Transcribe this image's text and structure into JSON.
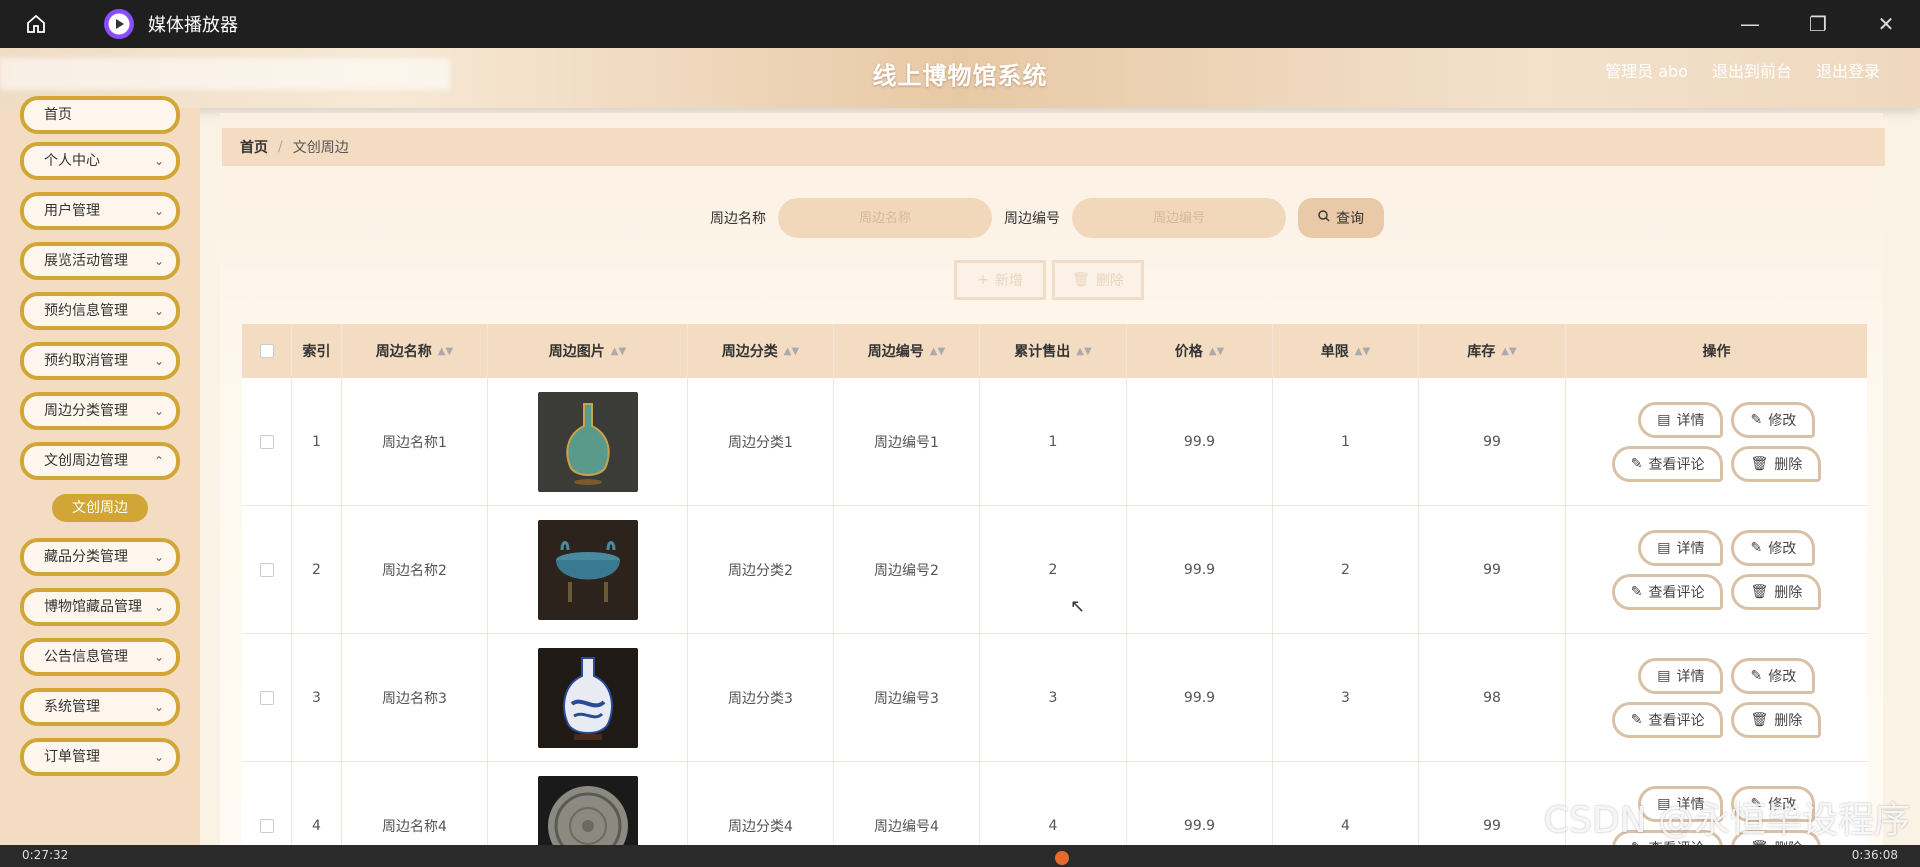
{
  "player": {
    "title": "媒体播放器",
    "time_left": "0:27:32",
    "time_right": "0:36:08"
  },
  "header": {
    "title": "线上博物馆系统",
    "admin": "管理员 abo",
    "front": "退出到前台",
    "logout": "退出登录"
  },
  "sidebar": {
    "items": [
      "首页",
      "个人中心",
      "用户管理",
      "展览活动管理",
      "预约信息管理",
      "预约取消管理",
      "周边分类管理",
      "文创周边管理",
      "藏品分类管理",
      "博物馆藏品管理",
      "公告信息管理",
      "系统管理",
      "订单管理"
    ],
    "active_sub": "文创周边"
  },
  "breadcrumb": {
    "home": "首页",
    "current": "文创周边"
  },
  "search": {
    "name_label": "周边名称",
    "name_placeholder": "周边名称",
    "code_label": "周边编号",
    "code_placeholder": "周边编号",
    "query": "查询"
  },
  "actions": {
    "add": "新增",
    "delete": "删除"
  },
  "table": {
    "headers": [
      "索引",
      "周边名称",
      "周边图片",
      "周边分类",
      "周边编号",
      "累计售出",
      "价格",
      "单限",
      "库存",
      "操作"
    ],
    "ops": {
      "detail": "详情",
      "edit": "修改",
      "comments": "查看评论",
      "delete": "删除"
    },
    "rows": [
      {
        "index": "1",
        "name": "周边名称1",
        "category": "周边分类1",
        "code": "周边编号1",
        "sold": "1",
        "price": "99.9",
        "limit": "1",
        "stock": "99",
        "image": "vase-teal"
      },
      {
        "index": "2",
        "name": "周边名称2",
        "category": "周边分类2",
        "code": "周边编号2",
        "sold": "2",
        "price": "99.9",
        "limit": "2",
        "stock": "99",
        "image": "censer-blue"
      },
      {
        "index": "3",
        "name": "周边名称3",
        "category": "周边分类3",
        "code": "周边编号3",
        "sold": "3",
        "price": "99.9",
        "limit": "3",
        "stock": "98",
        "image": "vase-blue-white"
      },
      {
        "index": "4",
        "name": "周边名称4",
        "category": "周边分类4",
        "code": "周边编号4",
        "sold": "4",
        "price": "99.9",
        "limit": "4",
        "stock": "99",
        "image": "bronze-mirror"
      }
    ]
  },
  "watermark": "CSDN @永恒毕设程序"
}
